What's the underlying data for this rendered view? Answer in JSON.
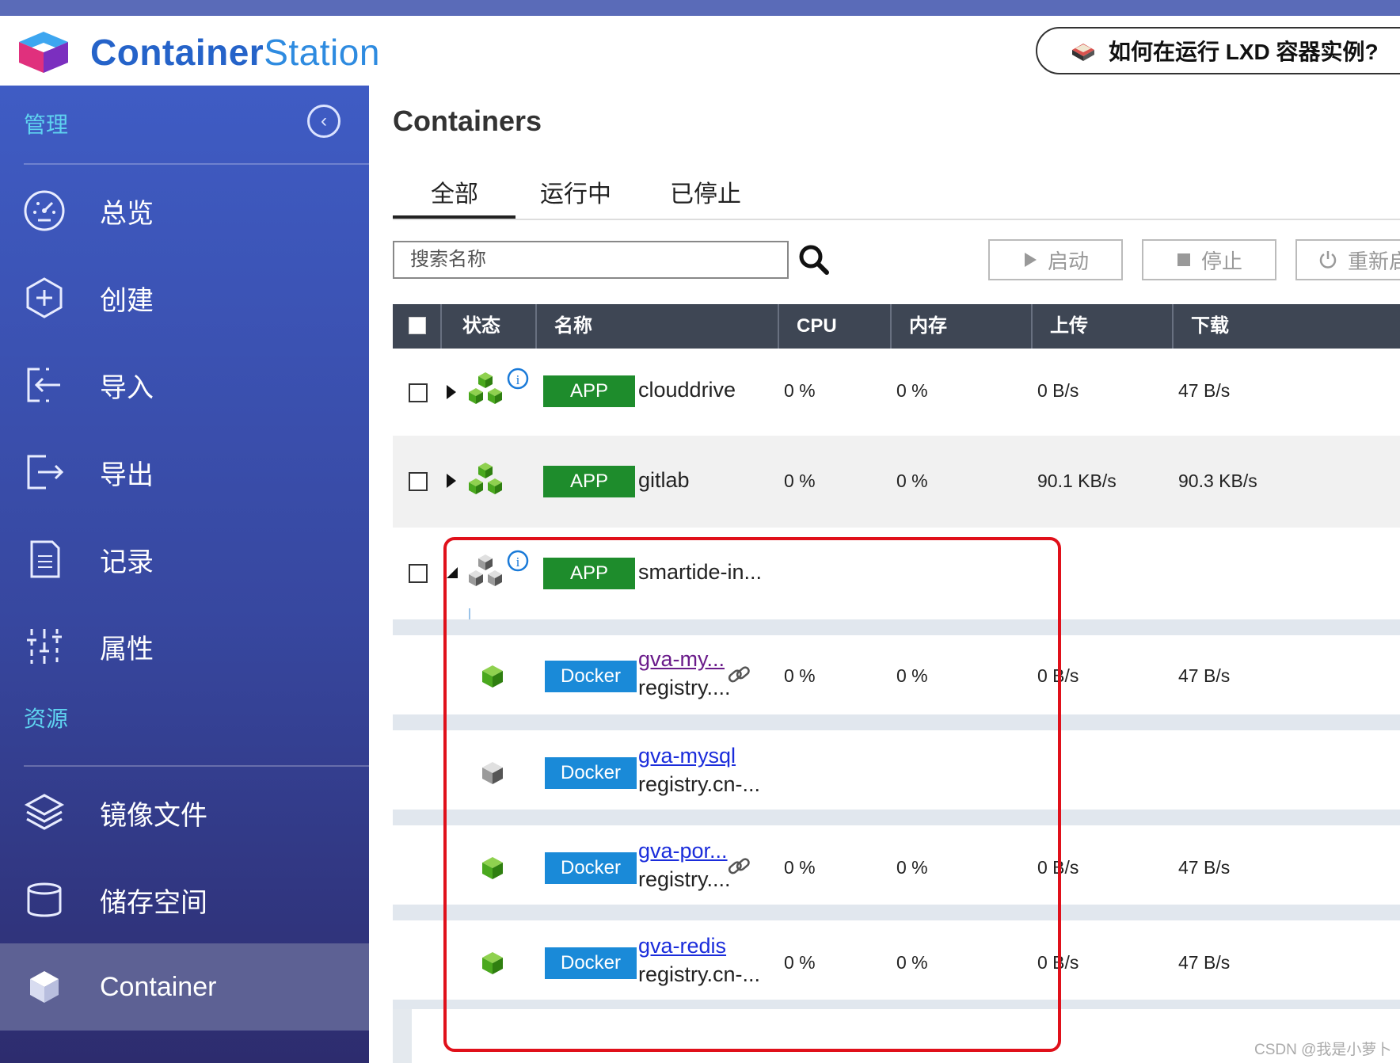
{
  "app": {
    "logo_part1": "Container",
    "logo_part2": "Station",
    "help_text": "如何在运行 LXD 容器实例?"
  },
  "sidebar": {
    "section_manage": "管理",
    "section_resources": "资源",
    "items": [
      {
        "label": "总览",
        "icon": "dashboard-icon"
      },
      {
        "label": "创建",
        "icon": "plus-circle-icon"
      },
      {
        "label": "导入",
        "icon": "import-icon"
      },
      {
        "label": "导出",
        "icon": "export-icon"
      },
      {
        "label": "记录",
        "icon": "log-icon"
      },
      {
        "label": "属性",
        "icon": "sliders-icon"
      }
    ],
    "resources": [
      {
        "label": "镜像文件",
        "icon": "layers-icon"
      },
      {
        "label": "储存空间",
        "icon": "storage-icon"
      },
      {
        "label": "Container",
        "icon": "cube-icon"
      }
    ]
  },
  "main": {
    "title": "Containers",
    "tabs": [
      "全部",
      "运行中",
      "已停止"
    ],
    "search_placeholder": "搜索名称",
    "actions": {
      "start": "启动",
      "stop": "停止",
      "restart": "重新启"
    },
    "columns": [
      "状态",
      "名称",
      "CPU",
      "内存",
      "上传",
      "下载"
    ]
  },
  "rows": [
    {
      "badge": "APP",
      "name": "clouddrive",
      "cpu": "0 %",
      "mem": "0 %",
      "up": "0 B/s",
      "down": "47 B/s"
    },
    {
      "badge": "APP",
      "name": "gitlab",
      "cpu": "0 %",
      "mem": "0 %",
      "up": "90.1 KB/s",
      "down": "90.3 KB/s"
    },
    {
      "badge": "APP",
      "name": "smartide-in..."
    }
  ],
  "children": [
    {
      "badge": "Docker",
      "name": "gva-my...",
      "sub": "registry....",
      "cpu": "0 %",
      "mem": "0 %",
      "up": "0 B/s",
      "down": "47 B/s"
    },
    {
      "badge": "Docker",
      "name": "gva-mysql",
      "sub": "registry.cn-..."
    },
    {
      "badge": "Docker",
      "name": "gva-por...",
      "sub": "registry....",
      "cpu": "0 %",
      "mem": "0 %",
      "up": "0 B/s",
      "down": "47 B/s"
    },
    {
      "badge": "Docker",
      "name": "gva-redis",
      "sub": "registry.cn-...",
      "cpu": "0 %",
      "mem": "0 %",
      "up": "0 B/s",
      "down": "47 B/s"
    }
  ],
  "watermark": "CSDN @我是小萝卜"
}
